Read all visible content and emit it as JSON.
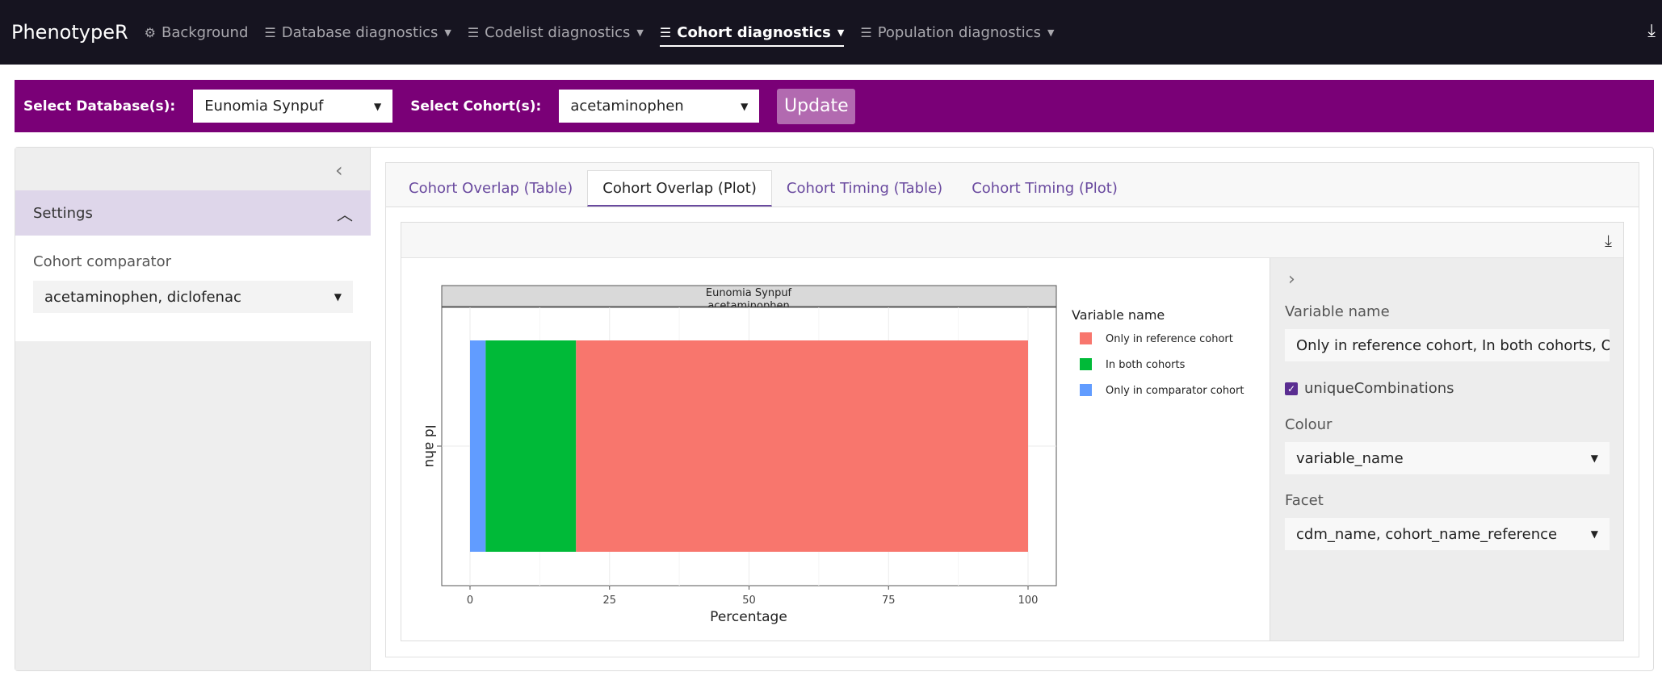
{
  "app": {
    "brand": "PhenotypeR"
  },
  "nav": {
    "items": [
      {
        "label": "Background",
        "icon": "gear-icon"
      },
      {
        "label": "Database diagnostics",
        "icon": "list-icon"
      },
      {
        "label": "Codelist diagnostics",
        "icon": "list-icon"
      },
      {
        "label": "Cohort diagnostics",
        "icon": "list-icon",
        "active": true
      },
      {
        "label": "Population diagnostics",
        "icon": "list-icon"
      }
    ],
    "download_icon": "download-icon"
  },
  "selection_bar": {
    "database_label": "Select Database(s):",
    "database_value": "Eunomia Synpuf",
    "cohort_label": "Select Cohort(s):",
    "cohort_value": "acetaminophen",
    "update_label": "Update",
    "bar_color": "#7a0077"
  },
  "sidebar": {
    "settings_label": "Settings",
    "comparator_label": "Cohort comparator",
    "comparator_value": "acetaminophen, diclofenac"
  },
  "tabs": [
    {
      "label": "Cohort Overlap (Table)"
    },
    {
      "label": "Cohort Overlap (Plot)",
      "active": true
    },
    {
      "label": "Cohort Timing (Table)"
    },
    {
      "label": "Cohort Timing (Plot)"
    }
  ],
  "plot_settings": {
    "variable_name_label": "Variable name",
    "variable_name_value": "Only in reference cohort, In both cohorts, Only",
    "unique_combinations_label": "uniqueCombinations",
    "unique_combinations_checked": true,
    "colour_label": "Colour",
    "colour_value": "variable_name",
    "facet_label": "Facet",
    "facet_value": "cdm_name, cohort_name_reference"
  },
  "chart_data": {
    "type": "bar",
    "orientation": "horizontal",
    "stacked": true,
    "facet_labels": [
      "Eunomia Synpuf",
      "acetaminophen"
    ],
    "xlabel": "Percentage",
    "ylabel": "Id ahu",
    "xlim": [
      0,
      100
    ],
    "x_ticks": [
      0,
      25,
      50,
      75,
      100
    ],
    "legend_title": "Variable name",
    "legend_position": "right",
    "grid": true,
    "series": [
      {
        "name": "Only in comparator cohort",
        "value": 2.8,
        "color": "#619cff"
      },
      {
        "name": "In both cohorts",
        "value": 16.2,
        "color": "#00ba38"
      },
      {
        "name": "Only in reference cohort",
        "value": 81.0,
        "color": "#f8766d"
      }
    ],
    "legend_order": [
      "Only in reference cohort",
      "In both cohorts",
      "Only in comparator cohort"
    ]
  }
}
